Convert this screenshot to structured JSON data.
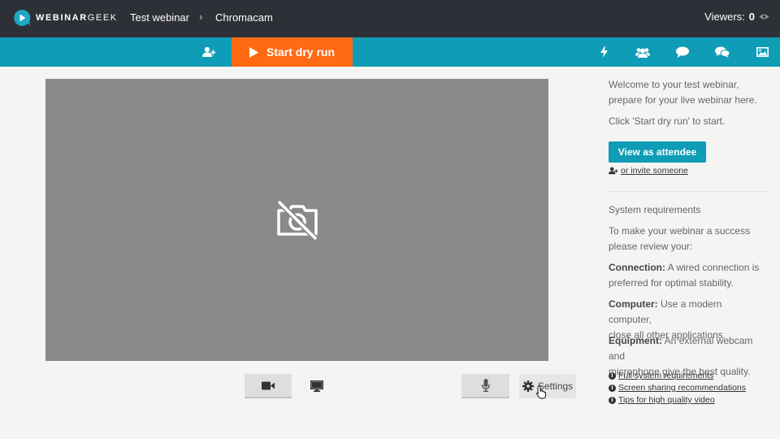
{
  "header": {
    "logo_text_bold": "WEBINAR",
    "logo_text_light": "GEEK",
    "breadcrumb": [
      "Test webinar",
      "Chromacam"
    ],
    "breadcrumb_separator": "›",
    "viewers_label": "Viewers:",
    "viewers_count": "0"
  },
  "toolbar": {
    "start_label": "Start dry run",
    "icons": [
      "add-user-icon",
      "lightning-icon",
      "users-icon",
      "chat-bubble-icon",
      "chat-bubbles-icon",
      "image-icon"
    ]
  },
  "video": {
    "state_icon": "camera-off-icon"
  },
  "controls": {
    "settings_label": "Settings"
  },
  "sidebar": {
    "welcome_line1": "Welcome to your test webinar,",
    "welcome_line2": "prepare for your live webinar here.",
    "click_hint": "Click 'Start dry run' to start.",
    "view_attendee_label": "View as attendee",
    "invite_label": "or invite someone",
    "sysreq_title": "System requirements",
    "sysreq_intro_1": "To make your webinar a success",
    "sysreq_intro_2": "please review your:",
    "connection_label": "Connection:",
    "connection_text_1": "A wired connection is",
    "connection_text_2": "preferred for optimal stability.",
    "computer_label": "Computer:",
    "computer_text_1": "Use a modern computer,",
    "computer_text_2": "close all other applications.",
    "equipment_label": "Equipment:",
    "equipment_text_1": "An external webcam and",
    "equipment_text_2": "microphone give the best quality.",
    "links": [
      "Full system requirements",
      "Screen sharing recommendations",
      "Tips for high quality video"
    ]
  },
  "colors": {
    "topbar": "#2e3037",
    "toolbar": "#0f9cb6",
    "start_button": "#ff6a13",
    "video_bg": "#8a8a8a"
  }
}
